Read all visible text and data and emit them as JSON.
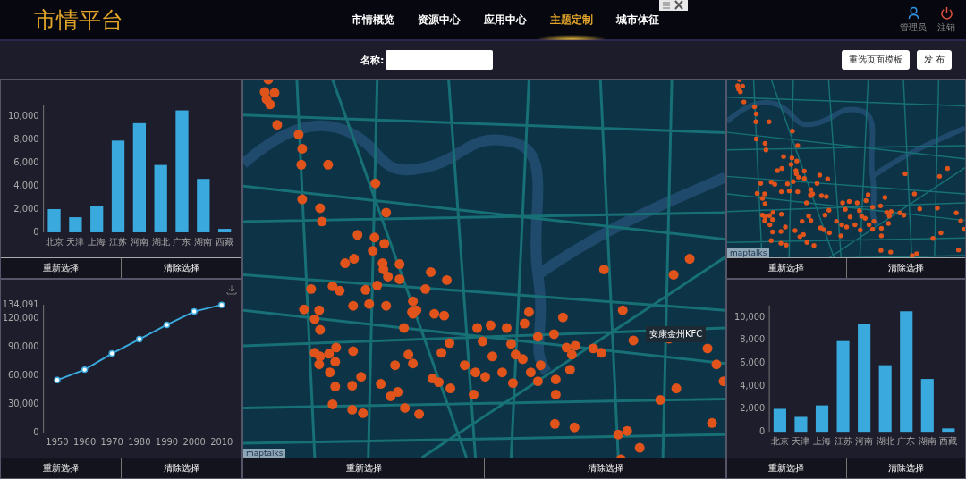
{
  "header": {
    "logo": "市情平台",
    "nav": [
      {
        "label": "市情概览",
        "selected": false
      },
      {
        "label": "资源中心",
        "selected": false
      },
      {
        "label": "应用中心",
        "selected": false
      },
      {
        "label": "主题定制",
        "selected": true
      },
      {
        "label": "城市体征",
        "selected": false
      }
    ],
    "user": "管理员",
    "logout": "注销"
  },
  "toolbar": {
    "name_label": "名称:",
    "buttons": [
      "重选页面模板",
      "发 布"
    ]
  },
  "panels": [
    {
      "kind": "chart",
      "actions": [
        "重新选择",
        "清除选择"
      ],
      "chart_data": {
        "type": "bar",
        "categories": [
          "北京",
          "天津",
          "上海",
          "江苏",
          "河南",
          "湖北",
          "广东",
          "湖南",
          "西藏"
        ],
        "values": [
          2000,
          1300,
          2300,
          7900,
          9400,
          5800,
          10500,
          4600,
          300
        ],
        "ylim": [
          0,
          11000
        ],
        "yticks": [
          {
            "value": 0,
            "label": "0"
          },
          {
            "value": 2000,
            "label": "2,000"
          },
          {
            "value": 4000,
            "label": "4,000"
          },
          {
            "value": 6000,
            "label": "6,000"
          },
          {
            "value": 8000,
            "label": "8,000"
          },
          {
            "value": 10000,
            "label": "10,000"
          }
        ]
      }
    },
    {
      "kind": "chart",
      "actions": [
        "重新选择",
        "清除选择"
      ],
      "chart_data": {
        "type": "line",
        "marker": true,
        "x": [
          "1950",
          "1960",
          "1970",
          "1980",
          "1990",
          "2000",
          "2010"
        ],
        "values": [
          55000,
          66000,
          83000,
          98000,
          113000,
          127000,
          134000
        ],
        "ylim": [
          0,
          134091
        ],
        "yticks": [
          {
            "value": 0,
            "label": "0"
          },
          {
            "value": 30000,
            "label": "30,000"
          },
          {
            "value": 60000,
            "label": "60,000"
          },
          {
            "value": 90000,
            "label": "90,000"
          },
          {
            "value": 120000,
            "label": "120,000"
          },
          {
            "value": 134091,
            "label": "134,091"
          }
        ]
      }
    },
    {
      "kind": "map",
      "actions": [
        "重新选择",
        "清除选择"
      ],
      "attribution": "maptalks",
      "popup": "安康金州KFC"
    },
    {
      "kind": "map",
      "actions": [
        "重新选择",
        "清除选择"
      ],
      "attribution": "maptalks"
    },
    {
      "kind": "chart",
      "actions": [
        "重新选择",
        "清除选择"
      ],
      "chart_data": {
        "type": "bar",
        "categories": [
          "北京",
          "天津",
          "上海",
          "江苏",
          "河南",
          "湖北",
          "广东",
          "湖南",
          "西藏"
        ],
        "values": [
          2000,
          1300,
          2300,
          7900,
          9400,
          5800,
          10500,
          4600,
          300
        ],
        "ylim": [
          0,
          11000
        ],
        "yticks": [
          {
            "value": 0,
            "label": "0"
          },
          {
            "value": 2000,
            "label": "2,000"
          },
          {
            "value": 4000,
            "label": "4,000"
          },
          {
            "value": 6000,
            "label": "6,000"
          },
          {
            "value": 8000,
            "label": "8,000"
          },
          {
            "value": 10000,
            "label": "10,000"
          }
        ]
      }
    }
  ]
}
